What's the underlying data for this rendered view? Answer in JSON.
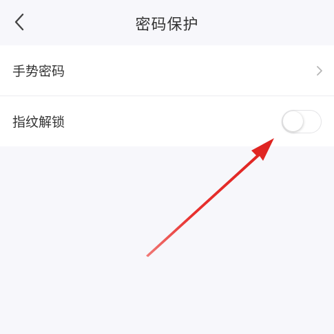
{
  "header": {
    "title": "密码保护",
    "back_icon": "chevron-left-icon"
  },
  "settings": {
    "gesture_password": {
      "label": "手势密码",
      "icon": "chevron-right-icon"
    },
    "fingerprint_unlock": {
      "label": "指纹解锁",
      "enabled": false
    }
  },
  "annotation": {
    "color": "#e8312f"
  }
}
